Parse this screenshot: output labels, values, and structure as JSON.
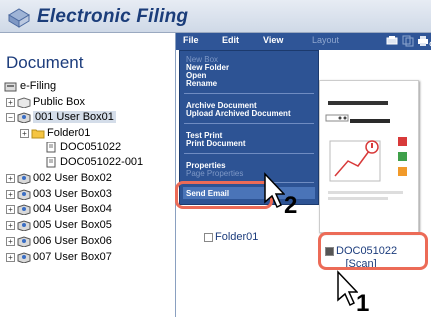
{
  "app": {
    "title": "Electronic Filing"
  },
  "left": {
    "heading": "Document",
    "tree": [
      {
        "label": "e-Filing"
      },
      {
        "label": "Public Box"
      },
      {
        "label": "001 User Box01"
      },
      {
        "label": "Folder01"
      },
      {
        "label": "DOC051022"
      },
      {
        "label": "DOC051022-001"
      },
      {
        "label": "002 User Box02"
      },
      {
        "label": "003 User Box03"
      },
      {
        "label": "004 User Box04"
      },
      {
        "label": "005 User Box05"
      },
      {
        "label": "006 User Box06"
      },
      {
        "label": "007 User Box07"
      }
    ]
  },
  "menubar": {
    "file": "File",
    "edit": "Edit",
    "view": "View",
    "layout": "Layout"
  },
  "dropdown": {
    "new_box": "New Box",
    "new_folder": "New Folder",
    "open": "Open",
    "rename": "Rename",
    "archive": "Archive Document",
    "upload": "Upload Archived Document",
    "test_print": "Test Print",
    "print_document": "Print Document",
    "properties": "Properties",
    "page_properties": "Page Properties",
    "send_email": "Send Email"
  },
  "main": {
    "folder_label": "Folder01",
    "doc_label": "DOC051022",
    "doc_sub": "[Scan]",
    "doc_checked": true
  },
  "callouts": {
    "step1": "1",
    "step2": "2"
  }
}
